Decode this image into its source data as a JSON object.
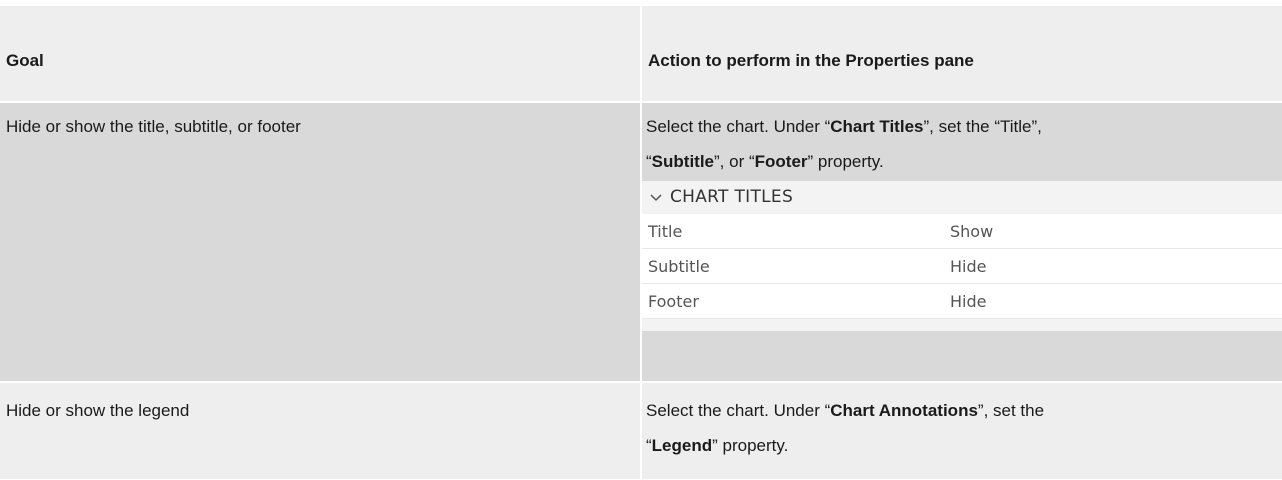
{
  "header": {
    "goal": "Goal",
    "action": "Action to perform in the Properties pane"
  },
  "rows": [
    {
      "goal": "Hide or show the title, subtitle, or footer",
      "action": {
        "t1": "Select the chart. Under “",
        "b1": "Chart Titles",
        "t2": "”, set the “Title”,",
        "t3": "“",
        "b2": "Subtitle",
        "t4": "”, or “",
        "b3": "Footer",
        "t5": "” property."
      },
      "pane": {
        "section_title": "CHART TITLES",
        "section_icon": "chevron-down-icon",
        "properties": [
          {
            "name": "Title",
            "value": "Show"
          },
          {
            "name": "Subtitle",
            "value": "Hide"
          },
          {
            "name": "Footer",
            "value": "Hide"
          }
        ]
      }
    },
    {
      "goal": "Hide or show the legend",
      "action": {
        "t1": "Select the chart. Under “",
        "b1": "Chart Annotations",
        "t2": "”, set the",
        "t3": "“",
        "b2": "Legend",
        "t4": "” property."
      }
    }
  ],
  "colors": {
    "header_bg": "#eeeeee",
    "row_dark_bg": "#d9d9d9",
    "row_light_bg": "#eeeeee",
    "pane_head_bg": "#f3f3f3"
  }
}
